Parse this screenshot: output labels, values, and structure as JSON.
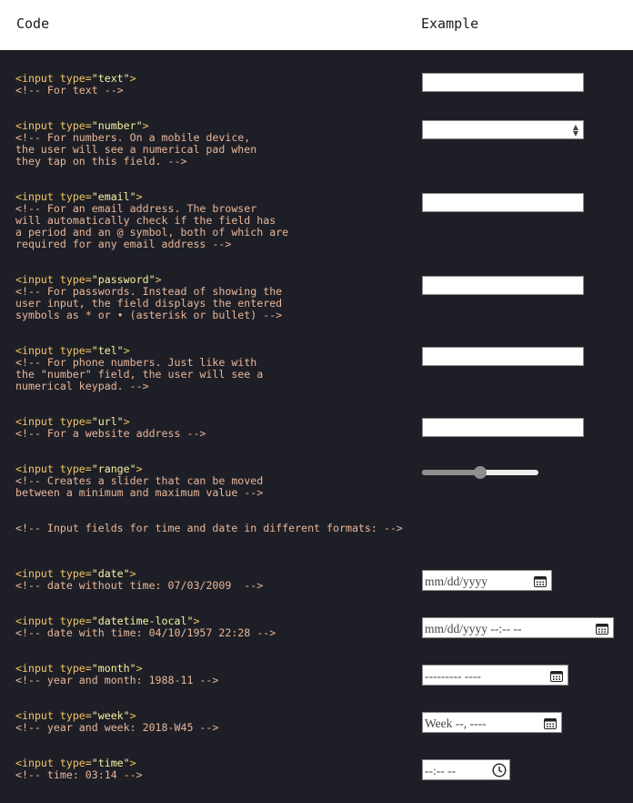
{
  "header": {
    "code_label": "Code",
    "example_label": "Example"
  },
  "rows": [
    {
      "tag_open": "<input type=",
      "type_val": "\"text\"",
      "tag_close": ">",
      "comment": "<!-- For text -->"
    },
    {
      "tag_open": "<input type=",
      "type_val": "\"number\"",
      "tag_close": ">",
      "comment": "<!-- For numbers. On a mobile device,\nthe user will see a numerical pad when\nthey tap on this field. -->"
    },
    {
      "tag_open": "<input type=",
      "type_val": "\"email\"",
      "tag_close": ">",
      "comment": "<!-- For an email address. The browser\nwill automatically check if the field has\na period and an @ symbol, both of which are\nrequired for any email address -->"
    },
    {
      "tag_open": "<input type=",
      "type_val": "\"password\"",
      "tag_close": ">",
      "comment": "<!-- For passwords. Instead of showing the\nuser input, the field displays the entered\nsymbols as * or • (asterisk or bullet) -->"
    },
    {
      "tag_open": "<input type=",
      "type_val": "\"tel\"",
      "tag_close": ">",
      "comment": "<!-- For phone numbers. Just like with\nthe \"number\" field, the user will see a\nnumerical keypad. -->"
    },
    {
      "tag_open": "<input type=",
      "type_val": "\"url\"",
      "tag_close": ">",
      "comment": "<!-- For a website address -->"
    },
    {
      "tag_open": "<input type=",
      "type_val": "\"range\"",
      "tag_close": ">",
      "comment": "<!-- Creates a slider that can be moved\nbetween a minimum and maximum value -->"
    },
    {
      "comment": "<!-- Input fields for time and date in different formats: -->"
    },
    {
      "tag_open": "<input type=",
      "type_val": "\"date\"",
      "tag_close": ">",
      "comment": "<!-- date without time: 07/03/2009  -->"
    },
    {
      "tag_open": "<input type=",
      "type_val": "\"datetime-local\"",
      "tag_close": ">",
      "comment": "<!-- date with time: 04/10/1957 22:28 -->"
    },
    {
      "tag_open": "<input type=",
      "type_val": "\"month\"",
      "tag_close": ">",
      "comment": "<!-- year and month: 1988-11 -->"
    },
    {
      "tag_open": "<input type=",
      "type_val": "\"week\"",
      "tag_close": ">",
      "comment": "<!-- year and week: 2018-W45 -->"
    },
    {
      "tag_open": "<input type=",
      "type_val": "\"time\"",
      "tag_close": ">",
      "comment": "<!-- time: 03:14 -->"
    }
  ],
  "fields": {
    "range_value": 0.5,
    "date_placeholder": "mm/dd/yyyy",
    "datetime_placeholder": "mm/dd/yyyy --:-- --",
    "month_placeholder": "--------- ----",
    "week_placeholder": "Week --, ----",
    "time_placeholder": "--:-- --"
  },
  "colors": {
    "background": "#1e1f26",
    "tag": "#f3c565",
    "string": "#f7f0a0",
    "comment": "#e8b69a"
  }
}
